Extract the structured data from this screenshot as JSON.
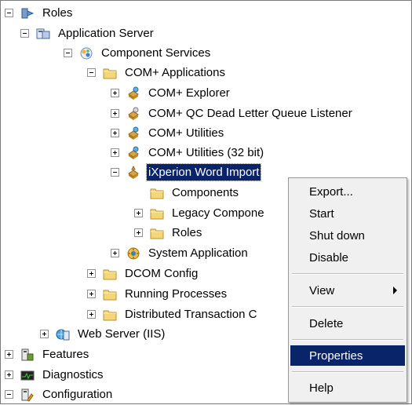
{
  "tree": [
    {
      "key": "roles",
      "label": "Roles",
      "expander": "minus",
      "icon": "roles-icon"
    },
    {
      "key": "app-server",
      "label": "Application Server",
      "expander": "minus",
      "icon": "server-icon"
    },
    {
      "key": "component-services",
      "label": "Component Services",
      "expander": "minus",
      "icon": "component-services-icon"
    },
    {
      "key": "com-applications",
      "label": "COM+ Applications",
      "expander": "minus",
      "icon": "folder-icon"
    },
    {
      "key": "com-explorer",
      "label": "COM+ Explorer",
      "expander": "plus",
      "icon": "com-app-icon"
    },
    {
      "key": "com-qc",
      "label": "COM+ QC Dead Letter Queue Listener",
      "expander": "plus",
      "icon": "com-app-icon"
    },
    {
      "key": "com-utilities",
      "label": "COM+ Utilities",
      "expander": "plus",
      "icon": "com-app-icon"
    },
    {
      "key": "com-utilities-32",
      "label": "COM+ Utilities (32 bit)",
      "expander": "plus",
      "icon": "com-app-icon"
    },
    {
      "key": "ixperion",
      "label": "iXperion Word Import",
      "expander": "minus",
      "icon": "com-app-icon",
      "selected": true
    },
    {
      "key": "components",
      "label": "Components",
      "expander": "none",
      "icon": "folder-icon"
    },
    {
      "key": "legacy",
      "label": "Legacy Compone",
      "expander": "plus",
      "icon": "folder-icon"
    },
    {
      "key": "roles-sub",
      "label": "Roles",
      "expander": "plus",
      "icon": "folder-icon"
    },
    {
      "key": "system-app",
      "label": "System Application",
      "expander": "plus",
      "icon": "system-app-icon"
    },
    {
      "key": "dcom",
      "label": "DCOM Config",
      "expander": "plus",
      "icon": "folder-icon"
    },
    {
      "key": "running",
      "label": "Running Processes",
      "expander": "plus",
      "icon": "folder-icon"
    },
    {
      "key": "dtc",
      "label": "Distributed Transaction C",
      "expander": "plus",
      "icon": "folder-icon"
    },
    {
      "key": "web-server",
      "label": "Web Server (IIS)",
      "expander": "plus",
      "icon": "web-server-icon"
    },
    {
      "key": "features",
      "label": "Features",
      "expander": "plus",
      "icon": "features-icon"
    },
    {
      "key": "diagnostics",
      "label": "Diagnostics",
      "expander": "plus",
      "icon": "diagnostics-icon"
    },
    {
      "key": "configuration",
      "label": "Configuration",
      "expander": "minus",
      "icon": "configuration-icon"
    }
  ],
  "context_menu": {
    "items": [
      {
        "label": "Export...",
        "highlighted": false,
        "submenu": false
      },
      {
        "label": "Start",
        "highlighted": false,
        "submenu": false
      },
      {
        "label": "Shut down",
        "highlighted": false,
        "submenu": false
      },
      {
        "label": "Disable",
        "highlighted": false,
        "submenu": false
      },
      {
        "label": "View",
        "highlighted": false,
        "submenu": true
      },
      {
        "label": "Delete",
        "highlighted": false,
        "submenu": false
      },
      {
        "label": "Properties",
        "highlighted": true,
        "submenu": false
      },
      {
        "label": "Help",
        "highlighted": false,
        "submenu": false
      }
    ]
  },
  "colors": {
    "selection": "#0a246a",
    "folder": "#f3d57a",
    "menu_bg": "#f0f0f0"
  }
}
